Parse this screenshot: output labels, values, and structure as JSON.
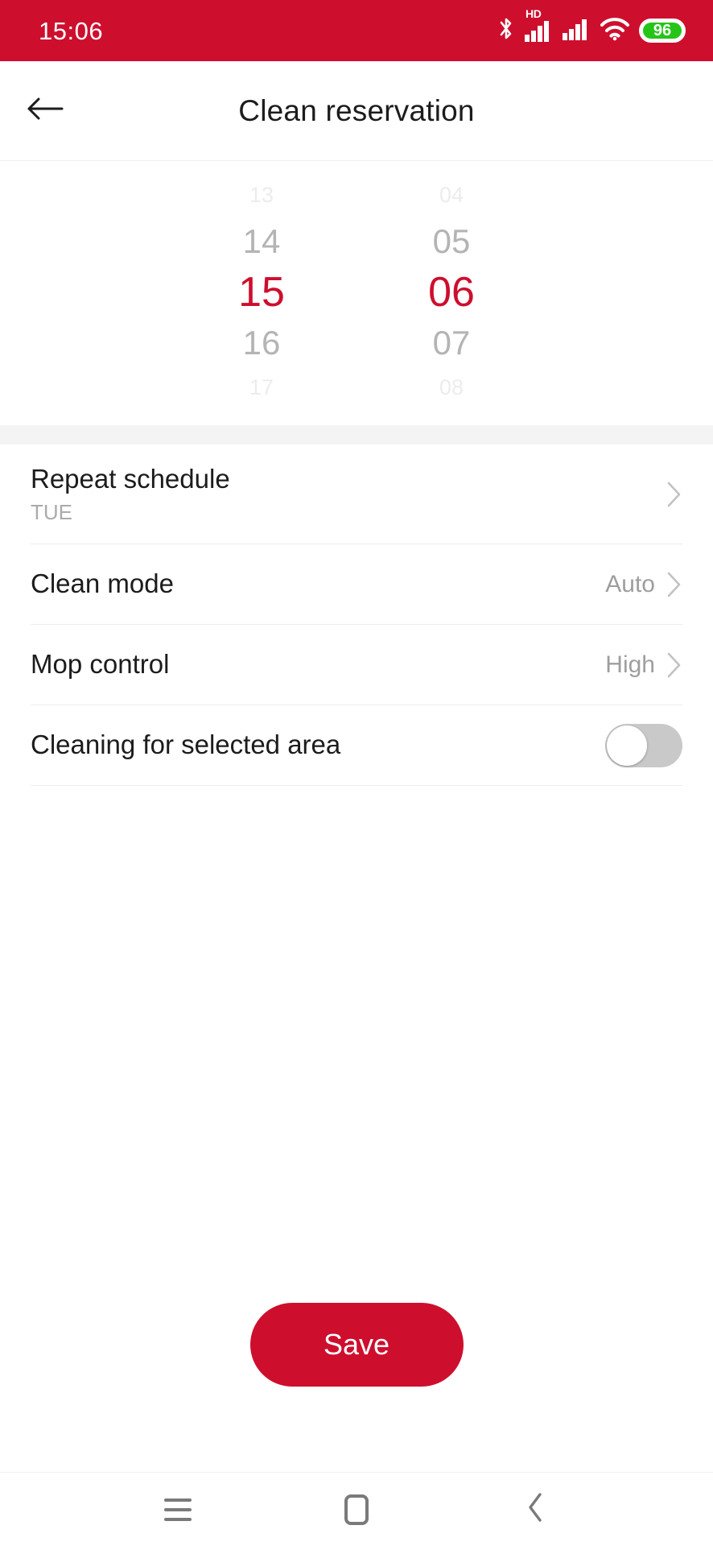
{
  "status_bar": {
    "time": "15:06",
    "icons": [
      "bluetooth-icon",
      "hd-signal-icon",
      "signal-icon",
      "wifi-icon",
      "battery-icon"
    ],
    "hd_label": "HD",
    "battery_percent": "96",
    "background_color": "#CE0E2D"
  },
  "app_bar": {
    "back_icon": "arrow-left-icon",
    "title": "Clean reservation"
  },
  "time_picker": {
    "selected_hour": "15",
    "selected_minute": "06",
    "hours": {
      "far_above": "13",
      "near_above": "14",
      "selected": "15",
      "near_below": "16",
      "far_below": "17"
    },
    "minutes": {
      "far_above": "04",
      "near_above": "05",
      "selected": "06",
      "near_below": "07",
      "far_below": "08"
    },
    "selected_color": "#CE0E2D"
  },
  "settings": {
    "rows": [
      {
        "title": "Repeat schedule",
        "subtitle": "TUE",
        "value": "",
        "control": "chevron"
      },
      {
        "title": "Clean mode",
        "subtitle": "",
        "value": "Auto",
        "control": "chevron"
      },
      {
        "title": "Mop control",
        "subtitle": "",
        "value": "High",
        "control": "chevron"
      },
      {
        "title": "Cleaning for selected area",
        "subtitle": "",
        "value": "",
        "control": "toggle",
        "toggle_on": false
      }
    ]
  },
  "actions": {
    "save_label": "Save",
    "save_color": "#CE0E2D"
  },
  "nav_bar": {
    "recents_icon": "menu-icon",
    "home_icon": "home-square-icon",
    "back_icon": "chevron-left-icon"
  }
}
